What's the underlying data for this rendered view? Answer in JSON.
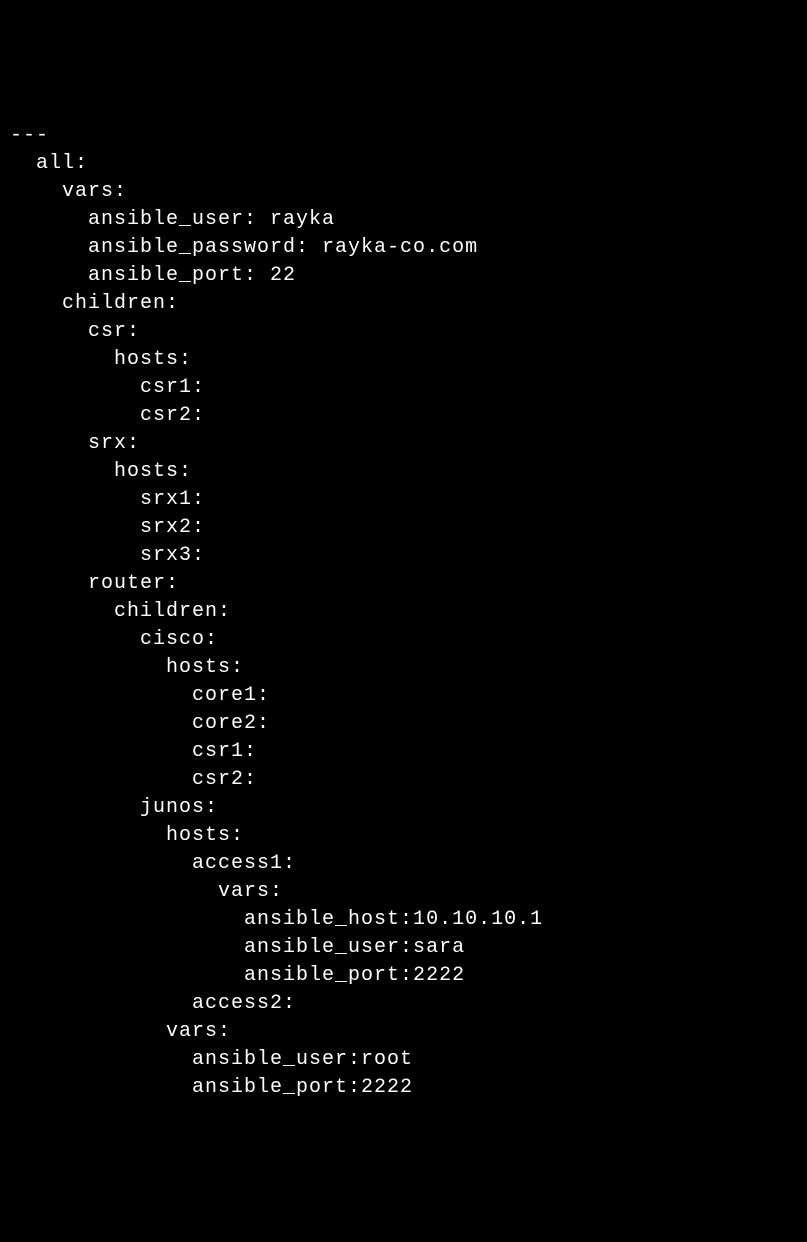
{
  "lines": {
    "l00": "---",
    "l01": "  all:",
    "l02": "    vars:",
    "l03": "      ansible_user: rayka",
    "l04": "      ansible_password: rayka-co.com",
    "l05": "      ansible_port: 22",
    "l06": "    children:",
    "l07": "      csr:",
    "l08": "        hosts:",
    "l09": "          csr1:",
    "l10": "          csr2:",
    "l11": "      srx:",
    "l12": "        hosts:",
    "l13": "          srx1:",
    "l14": "          srx2:",
    "l15": "          srx3:",
    "l16": "      router:",
    "l17": "        children:",
    "l18": "          cisco:",
    "l19": "            hosts:",
    "l20": "              core1:",
    "l21": "              core2:",
    "l22": "              csr1:",
    "l23": "              csr2:",
    "l24": "          junos:",
    "l25": "            hosts:",
    "l26": "              access1:",
    "l27": "                vars:",
    "l28": "                  ansible_host:10.10.10.1",
    "l29": "                  ansible_user:sara",
    "l30": "                  ansible_port:2222",
    "l31": "              access2:",
    "l32": "            vars:",
    "l33": "              ansible_user:root",
    "l34": "              ansible_port:2222"
  }
}
